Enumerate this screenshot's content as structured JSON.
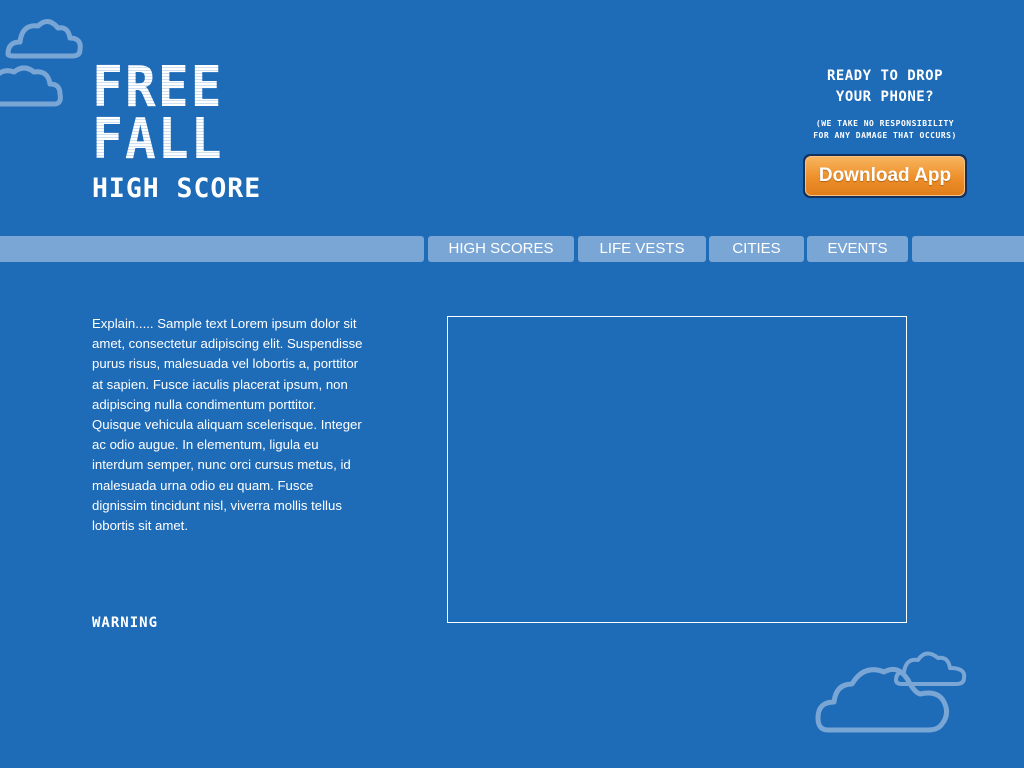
{
  "logo": {
    "line1": "FREE",
    "line2": "FALL",
    "subtitle": "HIGH SCORE"
  },
  "download": {
    "headline_line1": "READY TO DROP",
    "headline_line2": "YOUR PHONE?",
    "disclaimer_line1": "(WE TAKE NO RESPONSIBILITY",
    "disclaimer_line2": "FOR ANY DAMAGE THAT OCCURS)",
    "button_label": "Download App"
  },
  "nav": {
    "items": [
      {
        "label": "HIGH SCORES"
      },
      {
        "label": "LIFE VESTS"
      },
      {
        "label": "CITIES"
      },
      {
        "label": "EVENTS"
      }
    ]
  },
  "main": {
    "intro_text": "Explain..... Sample text Lorem ipsum dolor sit amet, consectetur adipiscing elit. Suspendisse purus risus, malesuada vel lobortis a, porttitor at sapien. Fusce iaculis placerat ipsum, non adipiscing nulla condimentum porttitor. Quisque vehicula aliquam scelerisque. Integer ac odio augue. In elementum, ligula eu interdum semper, nunc orci cursus metus, id malesuada urna odio eu quam. Fusce dignissim tincidunt nisl, viverra mollis tellus lobortis sit amet.",
    "warning_label": "WARNING"
  },
  "colors": {
    "background": "#1e6bb8",
    "nav_bar": "#7aa6d6",
    "button_orange": "#ed8f2a",
    "cloud_outline": "#7aa6d6"
  },
  "icons": {
    "cloud_top_left": "cloud-icon",
    "cloud_bottom_right": "cloud-icon"
  }
}
